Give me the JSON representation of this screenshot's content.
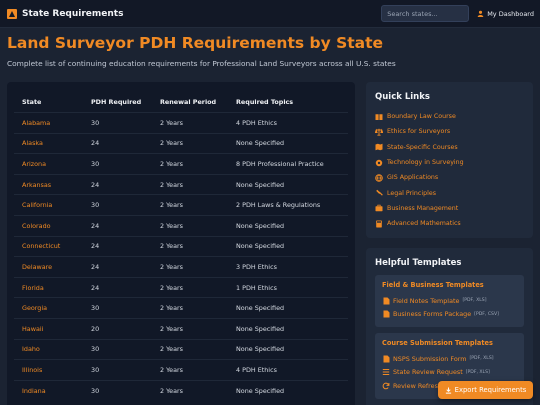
{
  "header": {
    "brand": "State Requirements",
    "search_placeholder": "Search states...",
    "dashboard_label": "My Dashboard"
  },
  "page": {
    "title": "Land Surveyor PDH Requirements by State",
    "subtitle": "Complete list of continuing education requirements for Professional Land Surveyors across all U.S. states"
  },
  "table": {
    "columns": [
      "State",
      "PDH Required",
      "Renewal Period",
      "Required Topics"
    ],
    "rows": [
      {
        "state": "Alabama",
        "pdh": "30",
        "period": "2 Years",
        "topics": "4 PDH Ethics"
      },
      {
        "state": "Alaska",
        "pdh": "24",
        "period": "2 Years",
        "topics": "None Specified"
      },
      {
        "state": "Arizona",
        "pdh": "30",
        "period": "2 Years",
        "topics": "8 PDH Professional Practice"
      },
      {
        "state": "Arkansas",
        "pdh": "24",
        "period": "2 Years",
        "topics": "None Specified"
      },
      {
        "state": "California",
        "pdh": "30",
        "period": "2 Years",
        "topics": "2 PDH Laws & Regulations"
      },
      {
        "state": "Colorado",
        "pdh": "24",
        "period": "2 Years",
        "topics": "None Specified"
      },
      {
        "state": "Connecticut",
        "pdh": "24",
        "period": "2 Years",
        "topics": "None Specified"
      },
      {
        "state": "Delaware",
        "pdh": "24",
        "period": "2 Years",
        "topics": "3 PDH Ethics"
      },
      {
        "state": "Florida",
        "pdh": "24",
        "period": "2 Years",
        "topics": "1 PDH Ethics"
      },
      {
        "state": "Georgia",
        "pdh": "30",
        "period": "2 Years",
        "topics": "None Specified"
      },
      {
        "state": "Hawaii",
        "pdh": "20",
        "period": "2 Years",
        "topics": "None Specified"
      },
      {
        "state": "Idaho",
        "pdh": "30",
        "period": "2 Years",
        "topics": "None Specified"
      },
      {
        "state": "Illinois",
        "pdh": "30",
        "period": "2 Years",
        "topics": "4 PDH Ethics"
      },
      {
        "state": "Indiana",
        "pdh": "30",
        "period": "2 Years",
        "topics": "None Specified"
      }
    ]
  },
  "quick_links": {
    "title": "Quick Links",
    "items": [
      {
        "label": "Boundary Law Course",
        "icon": "book-icon"
      },
      {
        "label": "Ethics for Surveyors",
        "icon": "balance-scale-icon"
      },
      {
        "label": "State-Specific Courses",
        "icon": "map-icon"
      },
      {
        "label": "Technology in Surveying",
        "icon": "gear-icon"
      },
      {
        "label": "GIS Applications",
        "icon": "globe-icon"
      },
      {
        "label": "Legal Principles",
        "icon": "gavel-icon"
      },
      {
        "label": "Business Management",
        "icon": "briefcase-icon"
      },
      {
        "label": "Advanced Mathematics",
        "icon": "calculator-icon"
      }
    ]
  },
  "templates": {
    "title": "Helpful Templates",
    "groups": [
      {
        "title": "Field & Business Templates",
        "items": [
          {
            "label": "Field Notes Template",
            "formats": "[PDF, XLS]"
          },
          {
            "label": "Business Forms Package",
            "formats": "[PDF, CSV]"
          }
        ]
      },
      {
        "title": "Course Submission Templates",
        "items": [
          {
            "label": "NSPS Submission Form",
            "formats": "[PDF, XLS]"
          },
          {
            "label": "State Review Request",
            "formats": "[PDF, XLS]"
          },
          {
            "label": "Review Refresh",
            "formats": ""
          }
        ]
      }
    ]
  },
  "export": {
    "label": "Export Requirements"
  },
  "colors": {
    "accent": "#f08a24",
    "background": "#1b2332",
    "card": "#111827",
    "sidecard": "#202a3b"
  }
}
